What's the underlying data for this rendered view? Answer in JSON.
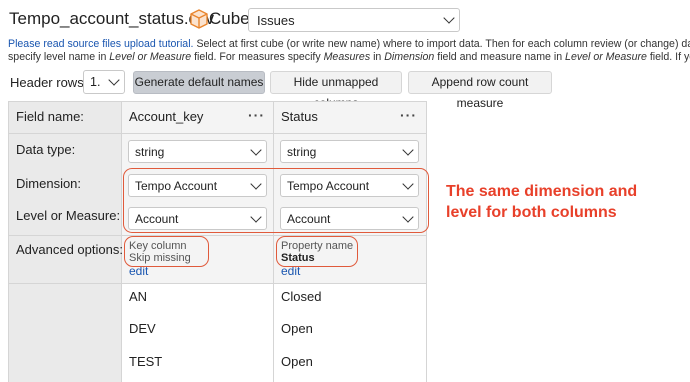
{
  "header": {
    "file_name": "Tempo_account_status.csv",
    "cube_label": "Cube:",
    "cube_value": "Issues",
    "cube_icon": "cube-icon"
  },
  "help": {
    "link_text": "Please read source files upload tutorial.",
    "line1_rest": " Select at first cube (or write new name) where to import data. Then for each column review (or change) da",
    "line2_a": "specify level name in ",
    "line2_b": "Level or Measure",
    "line2_c": " field. For measures specify ",
    "line2_d": "Measures",
    "line2_e": " in ",
    "line2_f": "Dimension",
    "line2_g": " field and measure name in ",
    "line2_h": "Level or Measure",
    "line2_i": " field. If you"
  },
  "toolbar": {
    "header_rows_label": "Header rows",
    "header_rows_value": "1.",
    "generate_label": "Generate default names",
    "hide_label": "Hide unmapped columns",
    "append_label": "Append row count measure"
  },
  "table": {
    "labels": {
      "field_name": "Field name:",
      "data_type": "Data type:",
      "dimension": "Dimension:",
      "level": "Level or Measure:",
      "advanced": "Advanced options:"
    },
    "columns": [
      {
        "name": "Account_key",
        "menu": "···",
        "data_type": "string",
        "dimension": "Tempo Account",
        "level": "Account",
        "options_line1": "Key column",
        "options_line2": "Skip missing",
        "edit": "edit",
        "rows": [
          "AN",
          "DEV",
          "TEST"
        ]
      },
      {
        "name": "Status",
        "menu": "···",
        "data_type": "string",
        "dimension": "Tempo Account",
        "level": "Account",
        "options_line1": "Property name",
        "options_line2": "Status",
        "edit": "edit",
        "rows": [
          "Closed",
          "Open",
          "Open"
        ]
      }
    ]
  },
  "annotation": {
    "line1": "The same dimension and",
    "line2": "level for both columns",
    "color": "#e8402a"
  }
}
